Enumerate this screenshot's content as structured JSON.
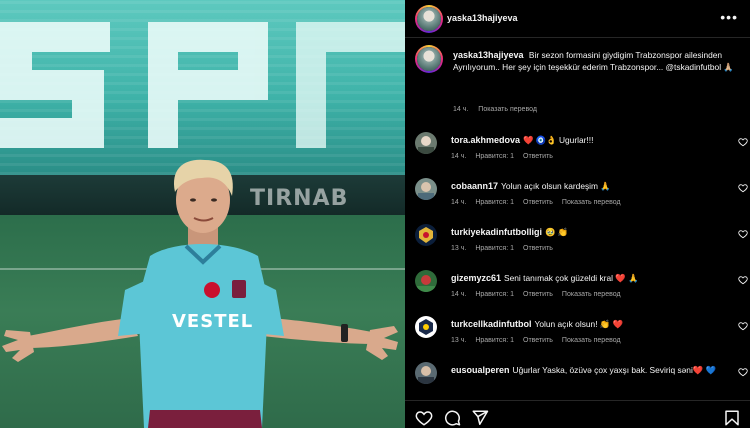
{
  "photo": {
    "stadium_letters": "SP",
    "ad_board_text": "TIRNAB",
    "shirt_sponsor": "VESTEL"
  },
  "post": {
    "author": "yaska13hajiyeva",
    "caption_text": "Bir sezon formasini giydigim Trabzonspor ailesinden Ayrılıyorum.. Her şey için teşekkür ederim Trabzonspor... @tskadinfutbol 🙏🏼",
    "time": "14 ч.",
    "see_translation": "Показать перевод"
  },
  "comments": [
    {
      "user": "tora.akhmedova",
      "text": "❤️ 🧿👌 Ugurlar!!!",
      "time": "14 ч.",
      "likes": "Нравится: 1",
      "reply": "Ответить",
      "translate": ""
    },
    {
      "user": "cobaann17",
      "text": "Yolun açık olsun kardeşim 🙏",
      "time": "14 ч.",
      "likes": "Нравится: 1",
      "reply": "Ответить",
      "translate": "Показать перевод"
    },
    {
      "user": "turkiyekadinfutbolligi",
      "text": "🥹 👏",
      "time": "13 ч.",
      "likes": "Нравится: 1",
      "reply": "Ответить",
      "translate": ""
    },
    {
      "user": "gizemyzc61",
      "text": "Seni tanımak çok güzeldi kral ❤️ 🙏",
      "time": "14 ч.",
      "likes": "Нравится: 1",
      "reply": "Ответить",
      "translate": "Показать перевод"
    },
    {
      "user": "turkcellkadinfutbol",
      "text": "Yolun açık olsun! 👏 ❤️",
      "time": "13 ч.",
      "likes": "Нравится: 1",
      "reply": "Ответить",
      "translate": "Показать перевод"
    },
    {
      "user": "eusoualperen",
      "text": "Uğurlar Yaska, özüvə çox yaxşı bak. Seviriq səni❤️ 💙",
      "time": "",
      "likes": "",
      "reply": "",
      "translate": ""
    }
  ],
  "icons": {
    "more": "more-options-icon",
    "like": "heart-icon",
    "comment": "comment-icon",
    "share": "share-icon",
    "save": "bookmark-icon"
  },
  "colors": {
    "shirt": "#5cc6d6",
    "background": "#000000",
    "muted_text": "#a8a8a8"
  }
}
